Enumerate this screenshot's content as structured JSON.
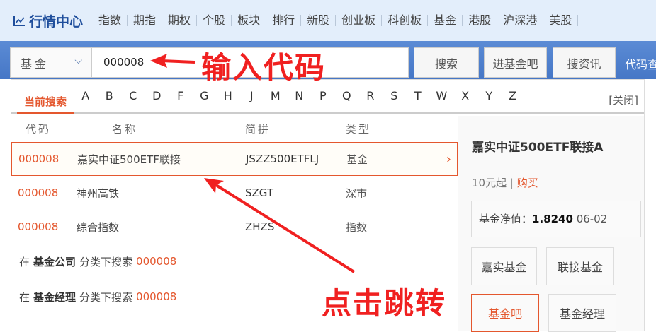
{
  "header": {
    "logo": "行情中心",
    "nav": [
      "指数",
      "期指",
      "期权",
      "个股",
      "板块",
      "排行",
      "新股",
      "创业板",
      "科创板",
      "基金",
      "港股",
      "沪深港",
      "美股"
    ]
  },
  "search": {
    "category": "基金",
    "value": "000008",
    "buttons": [
      "搜索",
      "进基金吧",
      "搜资讯"
    ],
    "extra": "代码查"
  },
  "dropdown": {
    "current_tab": "当前搜索",
    "letters": [
      "A",
      "B",
      "C",
      "D",
      "F",
      "G",
      "H",
      "J",
      "M",
      "N",
      "P",
      "Q",
      "R",
      "S",
      "T",
      "W",
      "X",
      "Y",
      "Z"
    ],
    "close": "[关闭]",
    "columns": [
      "代码",
      "名称",
      "简拼",
      "类型"
    ],
    "rows": [
      {
        "code": "000008",
        "name": "嘉实中证500ETF联接",
        "abbr": "JSZZ500ETFLJ",
        "type": "基金"
      },
      {
        "code": "000008",
        "name": "神州高铁",
        "abbr": "SZGT",
        "type": "深市"
      },
      {
        "code": "000008",
        "name": "综合指数",
        "abbr": "ZHZS",
        "type": "指数"
      }
    ],
    "categories": [
      {
        "pre": "在",
        "cat": "基金公司",
        "mid": "分类下搜索",
        "code": "000008"
      },
      {
        "pre": "在",
        "cat": "基金经理",
        "mid": "分类下搜索",
        "code": "000008"
      }
    ],
    "detail": {
      "title": "嘉实中证500ETF联接A",
      "min": "10元起",
      "sep": " | ",
      "buy": "购买",
      "nav_label": "基金净值：",
      "nav_value": "1.8240",
      "nav_date": "06-02",
      "buttons": [
        "嘉实基金",
        "联接基金",
        "基金吧",
        "基金经理"
      ]
    }
  },
  "annotations": {
    "input_hint": "输入代码",
    "click_hint": "点击跳转"
  },
  "colors": {
    "accent": "#e4572e",
    "band": "#4a7bc8",
    "annotation": "#f02020"
  }
}
